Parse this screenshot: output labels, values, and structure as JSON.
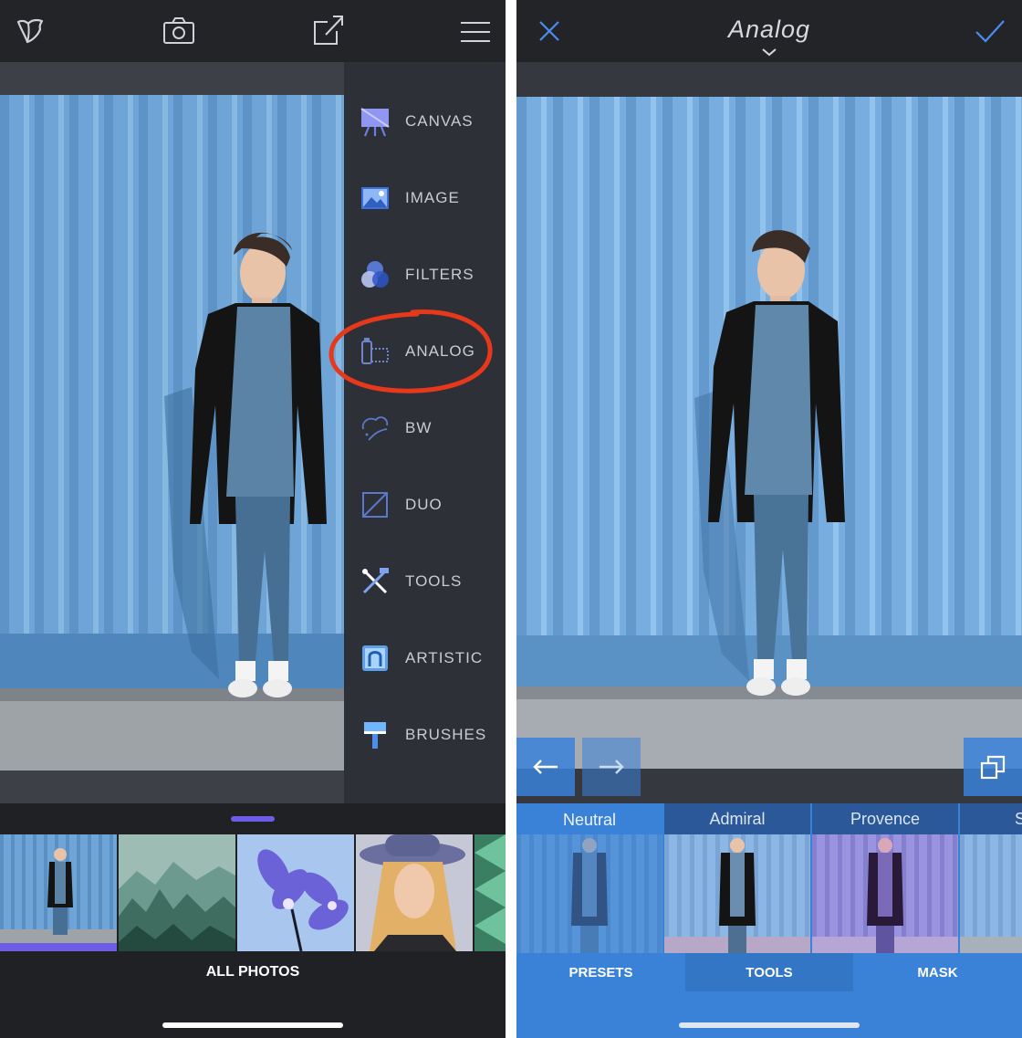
{
  "left_screen": {
    "menu": {
      "items": [
        {
          "label": "CANVAS",
          "icon": "easel-icon"
        },
        {
          "label": "IMAGE",
          "icon": "image-icon"
        },
        {
          "label": "FILTERS",
          "icon": "filters-icon"
        },
        {
          "label": "ANALOG",
          "icon": "film-canister-icon"
        },
        {
          "label": "BW",
          "icon": "bw-icon"
        },
        {
          "label": "DUO",
          "icon": "duo-icon"
        },
        {
          "label": "TOOLS",
          "icon": "tools-icon"
        },
        {
          "label": "ARTISTIC",
          "icon": "artistic-icon"
        },
        {
          "label": "BRUSHES",
          "icon": "brush-icon"
        }
      ],
      "highlighted_item": "ANALOG"
    },
    "bottom": {
      "all_photos_label": "ALL PHOTOS"
    }
  },
  "right_screen": {
    "title": "Analog",
    "presets": [
      {
        "label": "Neutral",
        "selected": true
      },
      {
        "label": "Admiral",
        "selected": false
      },
      {
        "label": "Provence",
        "selected": false
      },
      {
        "label": "S",
        "selected": false
      }
    ],
    "tabs": [
      {
        "label": "PRESETS",
        "selected": true
      },
      {
        "label": "TOOLS",
        "selected": false
      },
      {
        "label": "MASK",
        "selected": false
      }
    ]
  },
  "colors": {
    "accent_purple": "#6d5ce6",
    "accent_blue": "#3a81d8",
    "annotation_red": "#e8381c",
    "dark_bg": "#27292e"
  }
}
